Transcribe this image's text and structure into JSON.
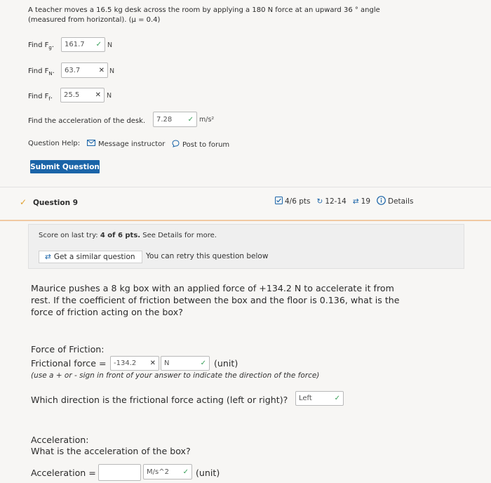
{
  "prev": {
    "problem": "A teacher moves a 16.5 kg desk across the room by applying a 180 N force at an upward 36 ° angle",
    "problem2": "(measured from horizontal). (μ = 0.4)",
    "find_fg": {
      "label_pre": "Find F",
      "sub": "g",
      "value": "161.7",
      "unit": "N"
    },
    "find_fn": {
      "label_pre": "Find F",
      "sub": "N",
      "value": "63.7",
      "unit": "N"
    },
    "find_ff": {
      "label_pre": "Find F",
      "sub": "f",
      "value": "25.5",
      "unit": "N"
    },
    "find_acc": {
      "label": "Find the acceleration of the desk.",
      "value": "7.28",
      "unit": "m/s²"
    },
    "help_label": "Question Help:",
    "message_instructor": "Message instructor",
    "post_forum": "Post to forum",
    "submit": "Submit Question"
  },
  "q9": {
    "title": "Question 9",
    "pts": "4/6 pts",
    "retries": "12-14",
    "attempts": "19",
    "details": "Details",
    "score_text_pre": "Score on last try: ",
    "score_bold": "4 of 6 pts.",
    "score_text_post": " See Details for more.",
    "similar": "Get a similar question",
    "retry_text": "You can retry this question below",
    "question_l1": "Maurice pushes a 8 kg box with an applied force of +134.2 N to accelerate it from",
    "question_l2": "rest. If the coefficient of friction between the box and the floor is 0.136, what is the",
    "question_l3": "force of friction acting on the box?",
    "friction_heading": "Force of Friction:",
    "friction_label": "Frictional force =",
    "friction_value": "-134.2",
    "friction_unit": "N",
    "unit_hint": "(unit)",
    "sign_hint": "(use a + or - sign in front of your answer to indicate the direction of the force)",
    "direction_q": "Which direction is the frictional force acting (left or right)?",
    "direction_value": "Left",
    "acc_heading": "Acceleration:",
    "acc_question": "What is the acceleration of the box?",
    "acc_label": "Acceleration =",
    "acc_value": "",
    "acc_unit": "M/s^2",
    "acc_unit_hint": "(unit)"
  }
}
